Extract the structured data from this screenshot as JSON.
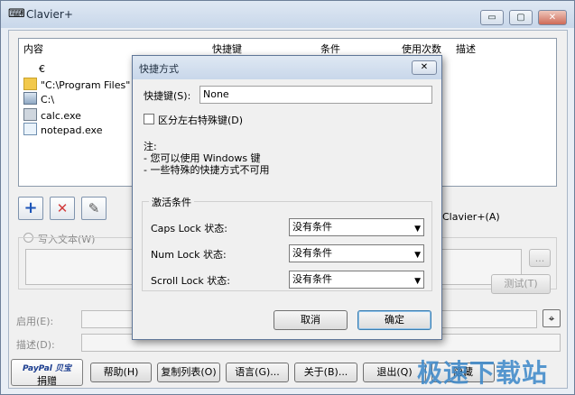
{
  "window": {
    "title": "Clavier+",
    "minimize": "▭",
    "maximize": "▢",
    "close": "✕"
  },
  "list": {
    "columns": [
      "内容",
      "快捷键",
      "条件",
      "使用次数",
      "描述"
    ],
    "rows": [
      {
        "label": "€",
        "icon": "blank-icon"
      },
      {
        "label": "\"C:\\Program Files\"",
        "icon": "folder-icon"
      },
      {
        "label": "C:\\",
        "icon": "drive-icon"
      },
      {
        "label": "calc.exe",
        "icon": "calculator-icon"
      },
      {
        "label": "notepad.exe",
        "icon": "notepad-icon"
      }
    ]
  },
  "toolbar": {
    "add": "+",
    "delete": "✕",
    "edit": "✎"
  },
  "main": {
    "write_text_label": "写入文本(W)",
    "clavier_shortcut": "Clavier+(A)",
    "browse": "...",
    "test_button": "测试(T)",
    "enable_label": "启用(E):",
    "description_label": "描述(D):"
  },
  "bottom": {
    "paypal": "PayPal 贝宝",
    "donate": "捐赠",
    "help": "帮助(H)",
    "copy_list": "复制列表(O)",
    "language": "语言(G)...",
    "about": "关于(B)...",
    "exit": "退出(Q)",
    "hidden": "隐藏"
  },
  "dialog": {
    "title": "快捷方式",
    "close": "✕",
    "shortcut_label": "快捷键(S):",
    "shortcut_value": "None",
    "distinguish_label": "区分左右特殊键(D)",
    "note_title": "注:",
    "note_line1": "- 您可以使用 Windows 键",
    "note_line2": "- 一些特殊的快捷方式不可用",
    "activation_title": "激活条件",
    "conditions": [
      {
        "label": "Caps Lock 状态:",
        "value": "没有条件"
      },
      {
        "label": "Num Lock 状态:",
        "value": "没有条件"
      },
      {
        "label": "Scroll Lock 状态:",
        "value": "没有条件"
      }
    ],
    "cancel": "取消",
    "ok": "确定"
  },
  "watermark": "极速下载站"
}
